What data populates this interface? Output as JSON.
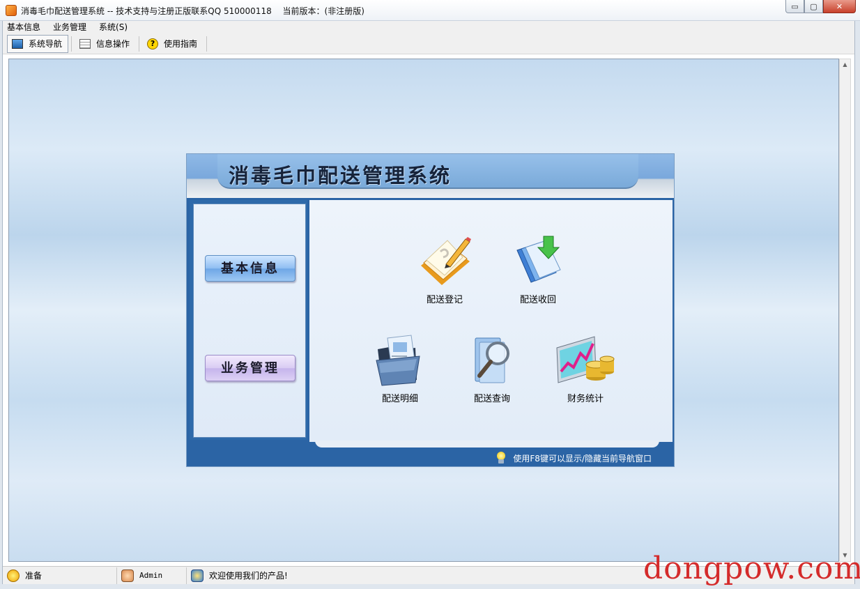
{
  "window": {
    "title": "消毒毛巾配送管理系统 -- 技术支持与注册正版联系QQ 510000118　 当前版本：(非注册版)",
    "buttons": {
      "minimize": "▭",
      "maximize": "▢",
      "close": "✕"
    }
  },
  "menubar": {
    "items": [
      {
        "label": "基本信息"
      },
      {
        "label": "业务管理"
      },
      {
        "label": "系统(S)"
      }
    ]
  },
  "toolbar": {
    "items": [
      {
        "label": "系统导航",
        "icon": "navigation-icon",
        "active": true
      },
      {
        "label": "信息操作",
        "icon": "info-grid-icon",
        "active": false
      },
      {
        "label": "使用指南",
        "icon": "help-icon",
        "active": false
      }
    ]
  },
  "panel": {
    "title": "消毒毛巾配送管理系统",
    "side_buttons": {
      "basic": "基本信息",
      "business": "业务管理"
    },
    "tiles": [
      {
        "label": "配送登记",
        "icon": "notebook-pencil-icon"
      },
      {
        "label": "配送收回",
        "icon": "documents-download-icon"
      },
      {
        "label": "配送明细",
        "icon": "folder-documents-icon"
      },
      {
        "label": "配送查询",
        "icon": "magnifier-search-icon"
      },
      {
        "label": "财务统计",
        "icon": "finance-chart-coins-icon"
      }
    ],
    "hint": "使用F8键可以显示/隐藏当前导航窗口"
  },
  "statusbar": {
    "ready": "准备",
    "user": "Admin",
    "welcome": "欢迎使用我们的产品!"
  },
  "watermark": "dongpow.com",
  "colors": {
    "panel_blue": "#2b64a5",
    "header_blue": "#8fb9e6",
    "watermark": "#d42b2b"
  }
}
